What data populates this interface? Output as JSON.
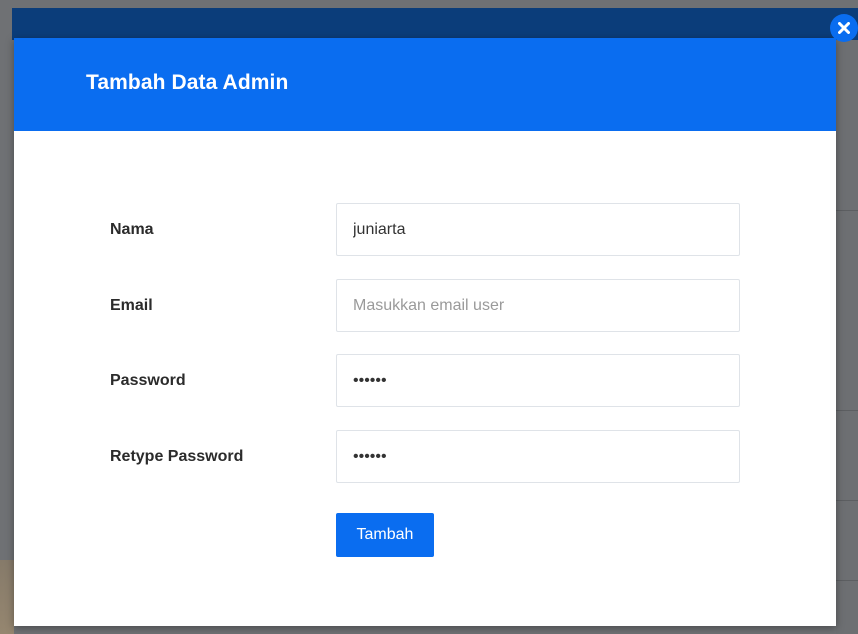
{
  "modal": {
    "title": "Tambah Data Admin",
    "close_icon": "close-icon"
  },
  "form": {
    "fields": [
      {
        "label": "Nama",
        "type": "text",
        "value": "juniarta",
        "placeholder": ""
      },
      {
        "label": "Email",
        "type": "email",
        "value": "",
        "placeholder": "Masukkan email user"
      },
      {
        "label": "Password",
        "type": "password",
        "value": "••••••",
        "placeholder": ""
      },
      {
        "label": "Retype Password",
        "type": "password",
        "value": "••••••",
        "placeholder": ""
      }
    ],
    "submit_label": "Tambah"
  },
  "colors": {
    "primary": "#0a6df0",
    "backdrop": "#6f7174",
    "navbar": "#0b3d7a"
  }
}
